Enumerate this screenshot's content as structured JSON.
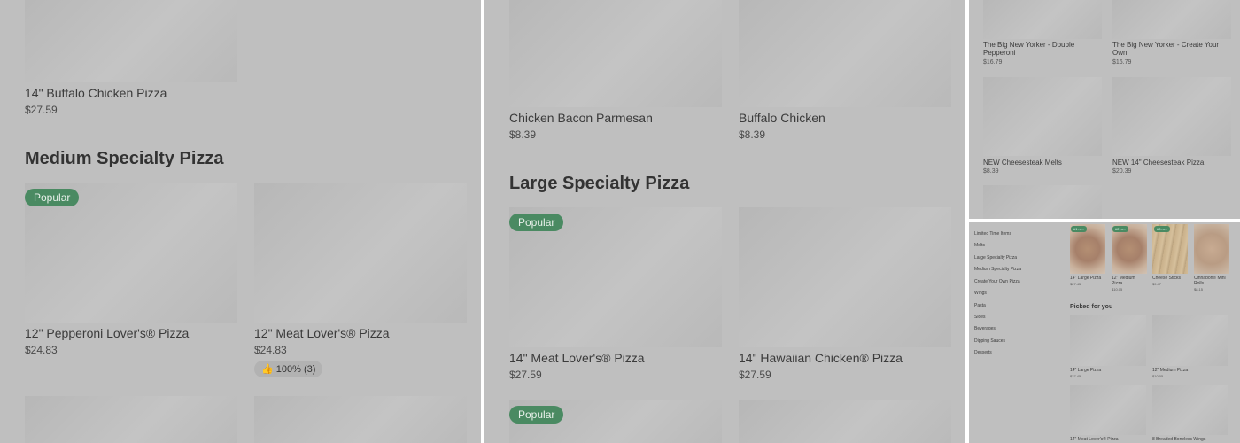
{
  "panel1": {
    "top_item": {
      "title": "14\" Buffalo Chicken Pizza",
      "price": "$27.59"
    },
    "section_heading": "Medium Specialty Pizza",
    "items": [
      {
        "title": "12\" Pepperoni Lover's® Pizza",
        "price": "$24.83",
        "badge": "Popular"
      },
      {
        "title": "12\" Meat Lover's® Pizza",
        "price": "$24.83",
        "rating": "100% (3)"
      }
    ]
  },
  "panel2": {
    "top_items": [
      {
        "title": "Chicken Bacon Parmesan",
        "price": "$8.39"
      },
      {
        "title": "Buffalo Chicken",
        "price": "$8.39"
      }
    ],
    "section_heading": "Large Specialty Pizza",
    "items": [
      {
        "title": "14\" Meat Lover's® Pizza",
        "price": "$27.59",
        "badge": "Popular"
      },
      {
        "title": "14\" Hawaiian Chicken® Pizza",
        "price": "$27.59"
      }
    ],
    "bottom_badge": "Popular"
  },
  "panel3": {
    "items": [
      {
        "title": "The Big New Yorker - Double Pepperoni",
        "price": "$16.79"
      },
      {
        "title": "The Big New Yorker - Create Your Own",
        "price": "$16.79"
      },
      {
        "title": "NEW Cheesesteak Melts",
        "price": "$8.39"
      },
      {
        "title": "NEW 14\" Cheesesteak Pizza",
        "price": "$20.39"
      }
    ]
  },
  "panel4": {
    "nav": [
      "Limited Time Items",
      "Melts",
      "Large Specialty Pizza",
      "Medium Specialty Pizza",
      "Create Your Own Pizza",
      "Wings",
      "Pasta",
      "Sides",
      "Beverages",
      "Dipping Sauces",
      "Desserts"
    ],
    "top_items": [
      {
        "title": "14\" Large Pizza",
        "price": "$27.45",
        "badge": "#1 m..."
      },
      {
        "title": "12\" Medium Pizza",
        "price": "$10.05",
        "badge": "#2 m..."
      },
      {
        "title": "Cheese Sticks",
        "price": "$9.47",
        "badge": "#3 m..."
      },
      {
        "title": "Cinnabon® Mini Rolls",
        "price": "$8.15"
      }
    ],
    "section_heading": "Picked for you",
    "picked": [
      {
        "title": "14\" Large Pizza",
        "price": "$27.45"
      },
      {
        "title": "12\" Medium Pizza",
        "price": "$10.05"
      },
      {
        "title": "14\" Meat Lover's® Pizza",
        "price": ""
      },
      {
        "title": "8 Breaded Boneless Wings",
        "price": ""
      }
    ]
  }
}
